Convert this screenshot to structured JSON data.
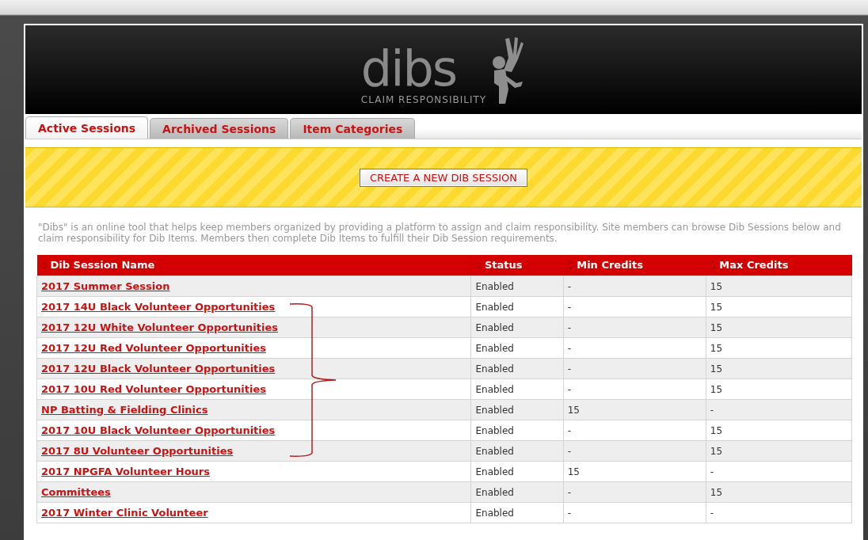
{
  "logo": {
    "wordmark": "dibs",
    "tagline": "CLAIM RESPONSIBILITY"
  },
  "tabs": [
    {
      "label": "Active Sessions",
      "selected": true
    },
    {
      "label": "Archived Sessions",
      "selected": false
    },
    {
      "label": "Item Categories",
      "selected": false
    }
  ],
  "create_button": "CREATE A NEW DIB SESSION",
  "description": "\"Dibs\" is an online tool that helps keep members organized by providing a platform to assign and claim responsibility. Site members can browse Dib Sessions below and claim responsibility for Dib Items. Members then complete Dib Items to fulfill their Dib Session requirements.",
  "table": {
    "columns": [
      "Dib Session Name",
      "Status",
      "Min Credits",
      "Max Credits"
    ],
    "rows": [
      {
        "name": "2017 Summer Session",
        "status": "Enabled",
        "min": "-",
        "max": "15"
      },
      {
        "name": "2017 14U Black Volunteer Opportunities",
        "status": "Enabled",
        "min": "-",
        "max": "15"
      },
      {
        "name": "2017 12U White Volunteer Opportunities",
        "status": "Enabled",
        "min": "-",
        "max": "15"
      },
      {
        "name": "2017 12U Red Volunteer Opportunities",
        "status": "Enabled",
        "min": "-",
        "max": "15"
      },
      {
        "name": "2017 12U Black Volunteer Opportunities",
        "status": "Enabled",
        "min": "-",
        "max": "15"
      },
      {
        "name": "2017 10U Red Volunteer Opportunities",
        "status": "Enabled",
        "min": "-",
        "max": "15"
      },
      {
        "name": "NP Batting & Fielding Clinics",
        "status": "Enabled",
        "min": "15",
        "max": "-"
      },
      {
        "name": "2017 10U Black Volunteer Opportunities",
        "status": "Enabled",
        "min": "-",
        "max": "15"
      },
      {
        "name": "2017 8U Volunteer Opportunities",
        "status": "Enabled",
        "min": "-",
        "max": "15"
      },
      {
        "name": "2017 NPGFA Volunteer Hours",
        "status": "Enabled",
        "min": "15",
        "max": "-"
      },
      {
        "name": "Committees",
        "status": "Enabled",
        "min": "-",
        "max": "15"
      },
      {
        "name": "2017 Winter Clinic Volunteer",
        "status": "Enabled",
        "min": "-",
        "max": "-"
      }
    ]
  }
}
